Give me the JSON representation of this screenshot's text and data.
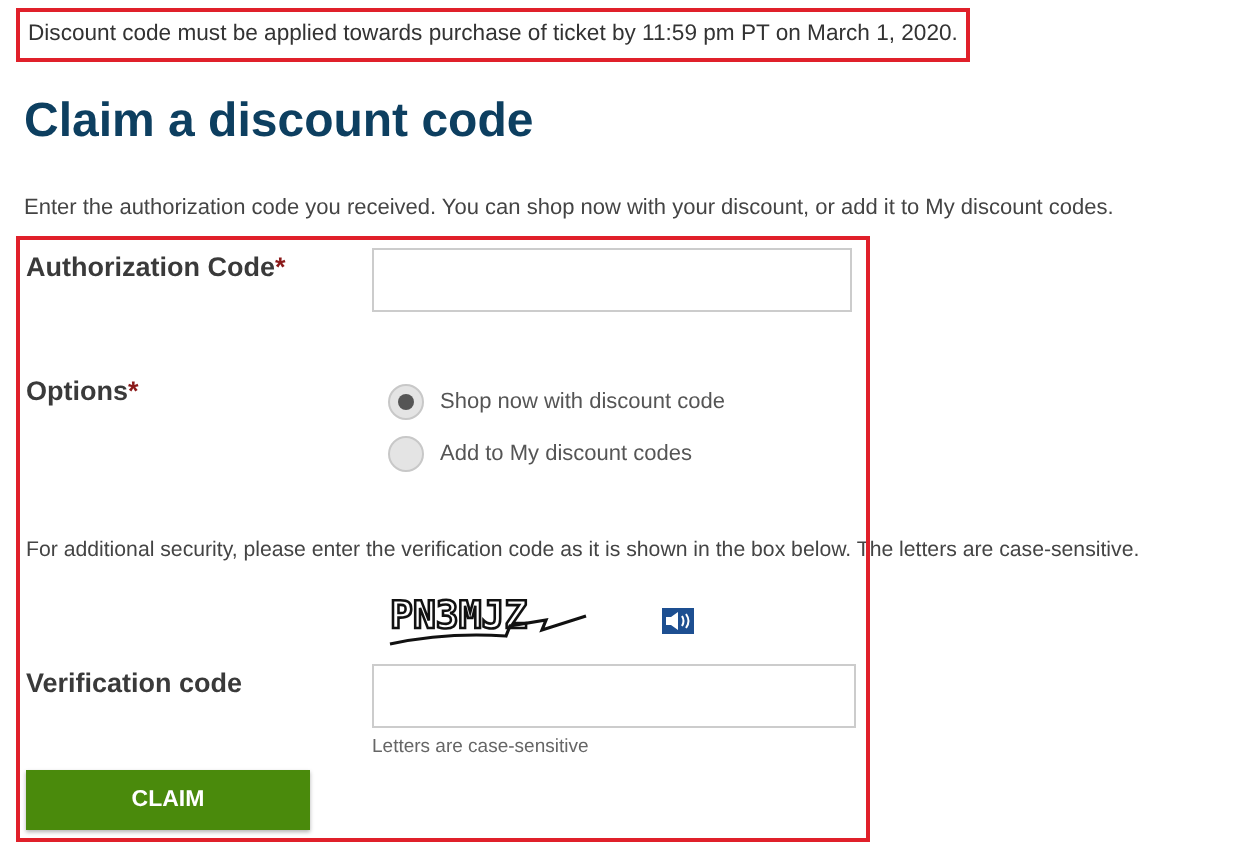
{
  "notice": "Discount code must be applied towards purchase of ticket by 11:59 pm PT on March 1, 2020.",
  "title": "Claim a discount code",
  "intro": "Enter the authorization code you received. You can shop now with your discount, or add it to My discount codes.",
  "authorization": {
    "label": "Authorization Code",
    "required_mark": "*"
  },
  "options": {
    "label": "Options",
    "required_mark": "*",
    "choices": [
      {
        "label": "Shop now with discount code",
        "selected": true
      },
      {
        "label": "Add to My discount codes",
        "selected": false
      }
    ]
  },
  "security_note": "For additional security, please enter the verification code as it is shown in the box below. The letters are case-sensitive.",
  "captcha": {
    "text": "PN3MJZ"
  },
  "verification": {
    "label": "Verification code",
    "hint": "Letters are case-sensitive"
  },
  "claim_button": "CLAIM"
}
